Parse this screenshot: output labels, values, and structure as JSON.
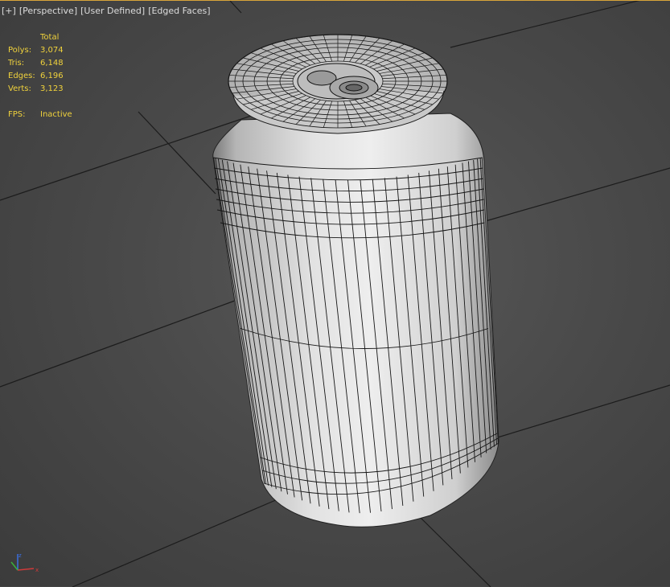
{
  "viewport": {
    "labels": [
      "+",
      "Perspective",
      "User Defined",
      "Edged Faces"
    ]
  },
  "stats": {
    "header": "Total",
    "rows": [
      {
        "label": "Polys:",
        "value": "3,074"
      },
      {
        "label": "Tris:",
        "value": "6,148"
      },
      {
        "label": "Edges:",
        "value": "6,196"
      },
      {
        "label": "Verts:",
        "value": "3,123"
      }
    ],
    "fps_label": "FPS:",
    "fps_value": "Inactive"
  },
  "colors": {
    "stats_text": "#f0d23c",
    "viewport_border": "#d8a43a",
    "grid_line": "#1c1c1c",
    "mesh_wire": "#161616"
  },
  "gizmo": {
    "icon": "axis-gizmo-icon"
  }
}
